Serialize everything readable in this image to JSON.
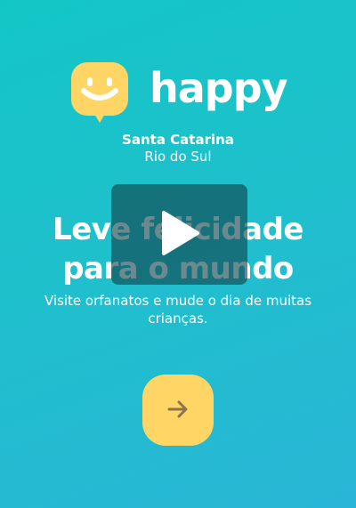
{
  "brand": {
    "name": "happy",
    "icon": "smile-chat-logo-icon",
    "accent_color": "#FFD666",
    "background_color": "#15C3D6"
  },
  "location": {
    "state": "Santa Catarina",
    "city": "Rio do Sul"
  },
  "hero": {
    "line1": "Leve felicidade",
    "line2": "para o mundo",
    "subtitle": "Visite orfanatos e mude o dia de muitas crianças."
  },
  "video": {
    "icon": "play-icon"
  },
  "actions": {
    "next_icon": "arrow-right-icon"
  }
}
